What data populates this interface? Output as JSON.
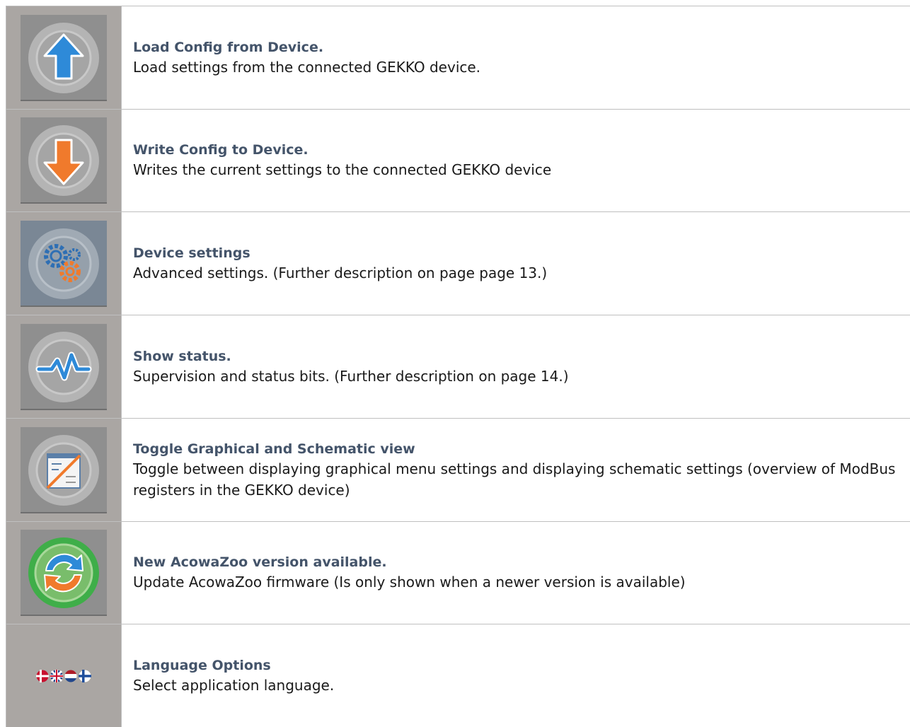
{
  "rows": [
    {
      "title": "Load Config from Device.",
      "desc": "Load settings from the connected GEKKO device.",
      "icon": "upload-arrow-icon",
      "accent": "#2e8ad8"
    },
    {
      "title": "Write Config to Device.",
      "desc": "Writes the current settings to the connected GEKKO device",
      "icon": "download-arrow-icon",
      "accent": "#f07a2c"
    },
    {
      "title": "Device settings",
      "desc": "Advanced settings. (Further description on page page 13.)",
      "icon": "gears-icon"
    },
    {
      "title": "Show status.",
      "desc": "Supervision and status bits. (Further description on page 14.)",
      "icon": "pulse-icon"
    },
    {
      "title": "Toggle Graphical and Schematic view",
      "desc": "Toggle between displaying graphical menu settings and displaying schematic settings (overview of ModBus registers in the GEKKO device)",
      "icon": "toggle-view-icon"
    },
    {
      "title": "New AcowaZoo version available.",
      "desc": "Update AcowaZoo firmware (Is only shown when a newer version is available)",
      "icon": "update-icon"
    },
    {
      "title": "Language Options",
      "desc": "Select application language.",
      "icon": "language-flags-icon"
    }
  ]
}
